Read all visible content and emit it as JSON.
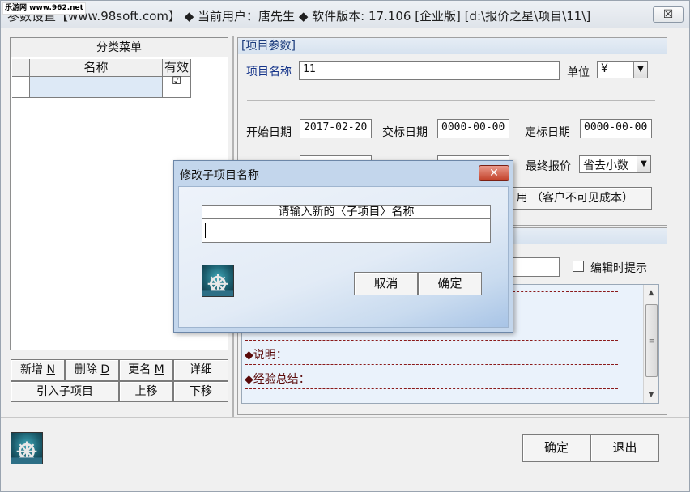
{
  "window": {
    "title": "参数设置【www.98soft.com】 ◆ 当前用户：唐先生 ◆ 软件版本: 17.106 [企业版] [d:\\报价之星\\项目\\11\\]",
    "close_symbol": "☒"
  },
  "watermark": "乐游网 www.962.net",
  "category_menu": {
    "title": "分类菜单",
    "col_name": "名称",
    "col_valid": "有效",
    "rows": [
      {
        "name": "",
        "valid_mark": "☑"
      }
    ],
    "buttons": {
      "add": "新增",
      "add_key": "N",
      "delete": "删除",
      "delete_key": "D",
      "rename": "更名",
      "rename_key": "M",
      "detail": "详细",
      "import": "引入子项目",
      "move_up": "上移",
      "move_down": "下移"
    }
  },
  "project_params": {
    "header": "[项目参数]",
    "name_label": "项目名称",
    "name_value": "11",
    "unit_label": "单位",
    "unit_value": "¥",
    "start_date_label": "开始日期",
    "start_date_value": "2017-02-20",
    "bid_date_label": "交标日期",
    "bid_date_value": "0000-00-00",
    "award_date_label": "定标日期",
    "award_date_value": "0000-00-00",
    "final_price_label": "最终报价",
    "final_price_value": "省去小数",
    "partial_button": "用 （客户不可见成本）",
    "edit_hint_label": "编辑时提示"
  },
  "notes": {
    "description_label": "◆说明：",
    "summary_label": "◆经验总结："
  },
  "scrollbar": {
    "up": "▲",
    "down": "▼",
    "thumb_grip": "≡"
  },
  "footer": {
    "ok": "确定",
    "exit": "退出"
  },
  "dialog": {
    "title": "修改子项目名称",
    "close_symbol": "✕",
    "prompt": "请输入新的〈子项目〉名称",
    "input_value": "",
    "cancel": "取消",
    "ok": "确定"
  },
  "icons": {
    "logo": "ship-wheel-icon"
  }
}
